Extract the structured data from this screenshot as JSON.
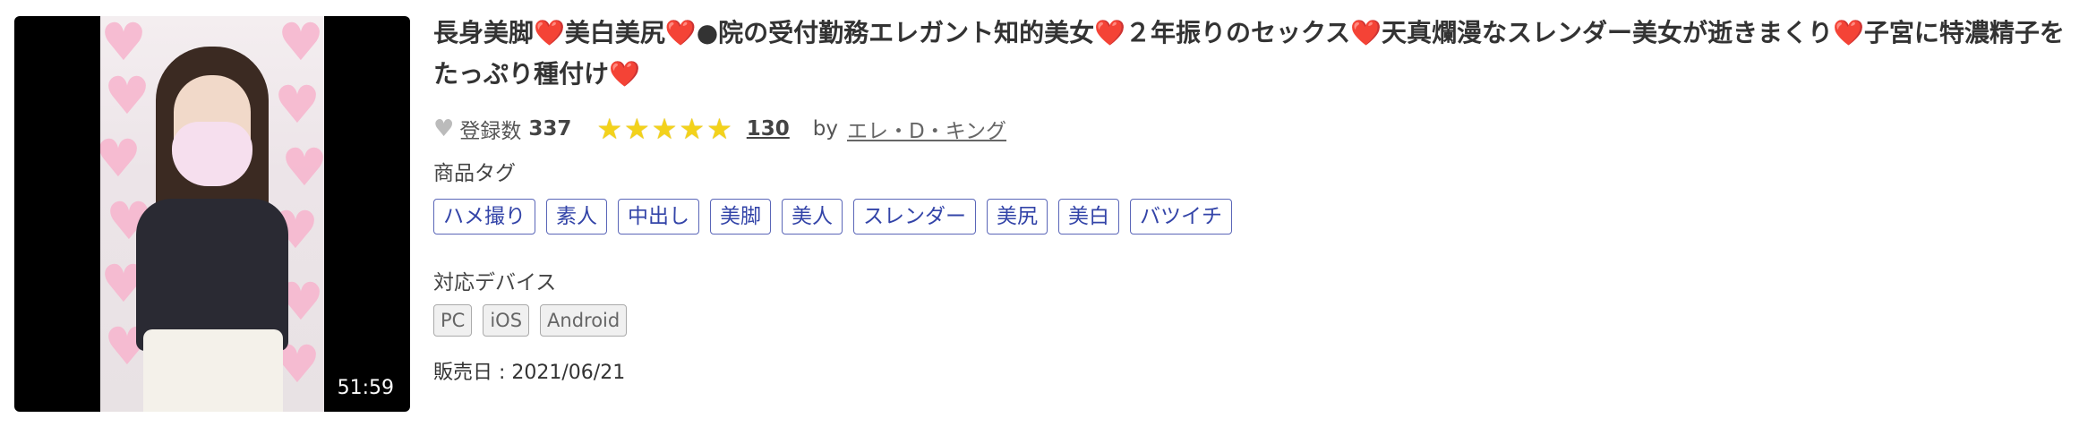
{
  "product": {
    "title": "長身美脚❤️美白美尻❤️●院の受付勤務エレガント知的美女❤️２年振りのセックス❤️天真爛漫なスレンダー美女が逝きまくり❤️子宮に特濃精子をたっぷり種付け❤️",
    "duration": "51:59",
    "favorites_label": "登録数",
    "favorites_count": "337",
    "rating": 5,
    "review_count": "130",
    "by_label": "by",
    "author": "エレ・D・キング",
    "tags_label": "商品タグ",
    "tags": [
      "ハメ撮り",
      "素人",
      "中出し",
      "美脚",
      "美人",
      "スレンダー",
      "美尻",
      "美白",
      "バツイチ"
    ],
    "devices_label": "対応デバイス",
    "devices": [
      "PC",
      "iOS",
      "Android"
    ],
    "release_label": "販売日 : 2021/06/21"
  },
  "icons": {
    "favorite": "heart-icon",
    "rating": "star-icon"
  },
  "colors": {
    "tag_text": "#3344a8",
    "star": "#f3d21b"
  }
}
